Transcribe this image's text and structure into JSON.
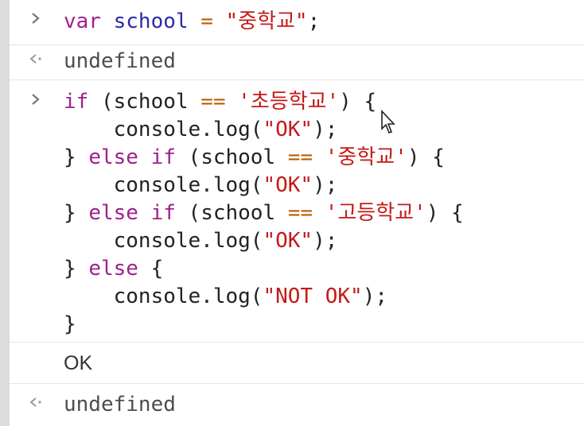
{
  "entry1": {
    "prompt_icon": "chevron-right-icon",
    "t1": "var",
    "t2": " ",
    "t3": "school",
    "t4": " ",
    "t5": "=",
    "t6": " ",
    "t7": "\"중학교\"",
    "t8": ";"
  },
  "result1": {
    "return_icon": "return-arrow-icon",
    "text": "undefined"
  },
  "entry2": {
    "prompt_icon": "chevron-right-icon",
    "l1": {
      "a": "if",
      "b": " (school ",
      "c": "==",
      "d": " ",
      "e": "'초등학교'",
      "f": ") {"
    },
    "l2": {
      "a": "    console.log(",
      "b": "\"OK\"",
      "c": ");"
    },
    "l3": {
      "a": "} ",
      "b": "else if",
      "c": " (school ",
      "d": "==",
      "e": " ",
      "f": "'중학교'",
      "g": ") {"
    },
    "l4": {
      "a": "    console.log(",
      "b": "\"OK\"",
      "c": ");"
    },
    "l5": {
      "a": "} ",
      "b": "else if",
      "c": " (school ",
      "d": "==",
      "e": " ",
      "f": "'고등학교'",
      "g": ") {"
    },
    "l6": {
      "a": "    console.log(",
      "b": "\"OK\"",
      "c": ");"
    },
    "l7": {
      "a": "} ",
      "b": "else",
      "c": " {"
    },
    "l8": {
      "a": "    console.log(",
      "b": "\"NOT OK\"",
      "c": ");"
    },
    "l9": {
      "a": "}"
    }
  },
  "output1": {
    "text": "OK"
  },
  "result2": {
    "return_icon": "return-arrow-icon",
    "text": "undefined"
  },
  "cursor_icon": "mouse-pointer-icon"
}
